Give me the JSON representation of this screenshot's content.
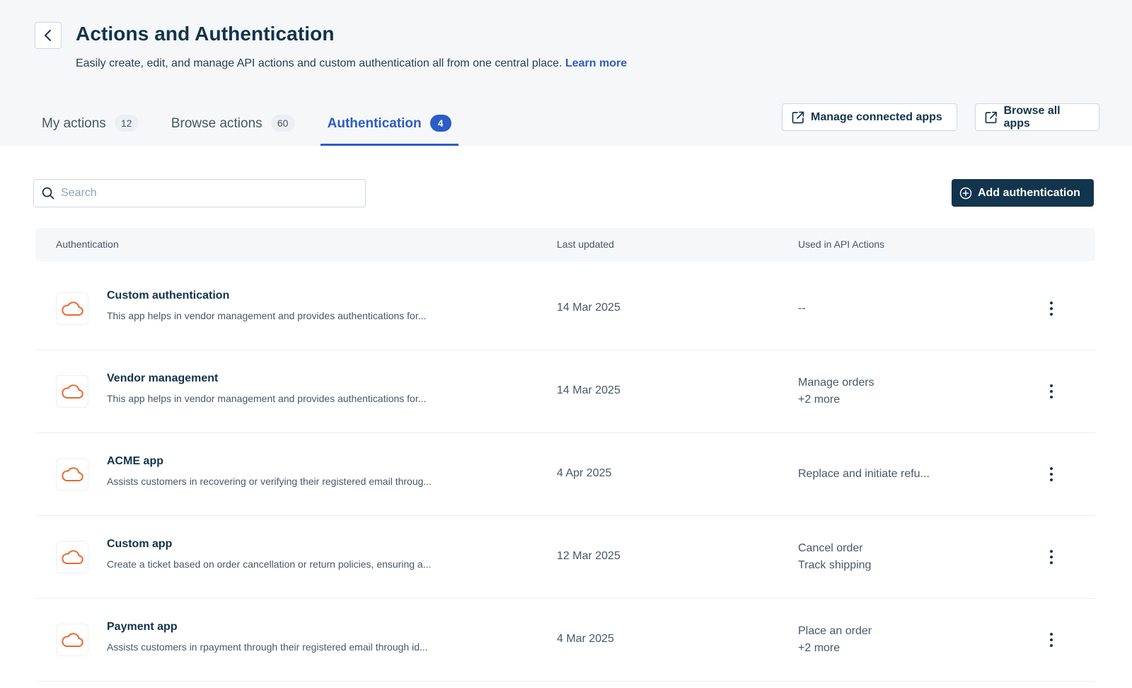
{
  "header": {
    "title": "Actions and Authentication",
    "subtitle": "Easily create, edit, and manage API actions and custom authentication all from one central place.",
    "learn_more": "Learn more",
    "back_icon": "chevron-left-icon"
  },
  "tabs": [
    {
      "label": "My actions",
      "count": "12",
      "active": false
    },
    {
      "label": "Browse actions",
      "count": "60",
      "active": false
    },
    {
      "label": "Authentication",
      "count": "4",
      "active": true
    }
  ],
  "header_buttons": {
    "manage_connected_apps": "Manage connected apps",
    "browse_all_apps": "Browse all apps",
    "icon": "external-link-icon"
  },
  "search": {
    "placeholder": "Search",
    "value": ""
  },
  "add_button": {
    "label": "Add authentication",
    "icon": "plus-circle-icon"
  },
  "table": {
    "columns": [
      "Authentication",
      "Last updated",
      "Used in API Actions"
    ],
    "rows": [
      {
        "name": "Custom authentication",
        "description": "This app helps in vendor management and provides authentications for...",
        "updated": "14 Mar 2025",
        "used": [
          "--"
        ]
      },
      {
        "name": "Vendor management",
        "description": "This app helps in vendor management and provides authentications for...",
        "updated": "14 Mar 2025",
        "used": [
          "Manage orders",
          "+2 more"
        ]
      },
      {
        "name": "ACME app",
        "description": "Assists customers in recovering or verifying their registered email throug...",
        "updated": "4 Apr 2025",
        "used": [
          "Replace and initiate refu..."
        ]
      },
      {
        "name": "Custom app",
        "description": "Create a ticket based on order cancellation or return policies, ensuring a...",
        "updated": "12 Mar 2025",
        "used": [
          "Cancel order",
          "Track shipping"
        ]
      },
      {
        "name": "Payment app",
        "description": "Assists customers in rpayment through their registered email through id...",
        "updated": "4 Mar 2025",
        "used": [
          "Place an order",
          "+2 more"
        ]
      }
    ]
  },
  "colors": {
    "accent": "#2c5cc5",
    "primary_dark": "#12344d",
    "header_bg": "#f5f7f9",
    "cloud_icon": "#e86a2f"
  },
  "row_icon": "cloud-icon"
}
